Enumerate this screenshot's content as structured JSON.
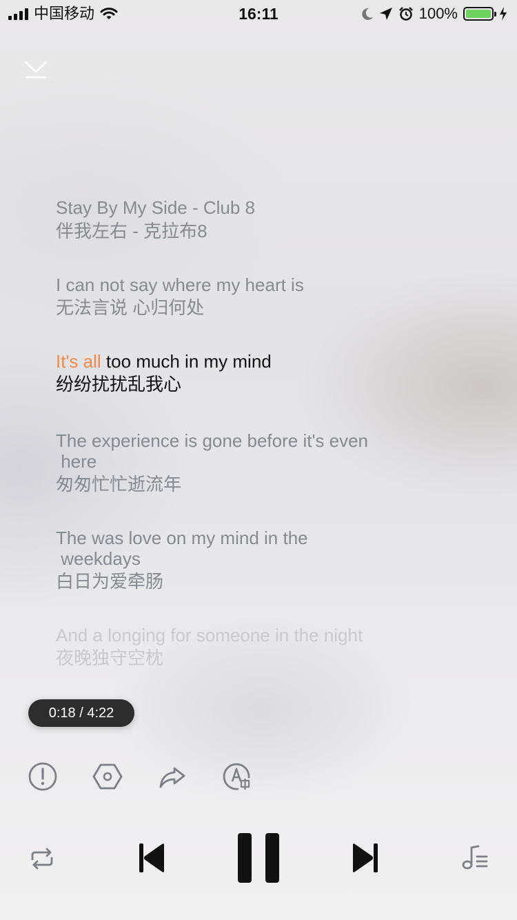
{
  "status_bar": {
    "carrier": "中国移动",
    "time": "16:11",
    "battery": "100%",
    "signal_icon": "signal-bars-icon",
    "wifi_icon": "wifi-icon",
    "icons": [
      "moon-icon",
      "location-arrow-icon",
      "alarm-icon",
      "battery-icon",
      "charging-bolt-icon"
    ]
  },
  "header": {
    "collapse_icon": "chevron-down-collapse-icon"
  },
  "lyrics": {
    "title": {
      "en": "Stay By My Side - Club 8",
      "cn": "伴我左右 - 克拉布8"
    },
    "lines": [
      {
        "en": "I can not say where my heart is",
        "cn": "无法言说 心归何处",
        "state": "past"
      },
      {
        "en_sung": "It's all",
        "en_rest": " too much in my mind",
        "cn": "纷纷扰扰乱我心",
        "state": "current"
      },
      {
        "en1": "The experience is gone before it's even",
        "en2": " here",
        "cn": "匆匆忙忙逝流年",
        "state": "upcoming"
      },
      {
        "en1": "The was love on my mind in the",
        "en2": " weekdays",
        "cn": "白日为爱牵肠",
        "state": "upcoming"
      },
      {
        "en": "And a longing for someone in the night",
        "cn": "夜晚独守空枕",
        "state": "faded"
      }
    ],
    "colors": {
      "highlight": "#f08a4b",
      "current": "#111111",
      "dim": "#878b91",
      "faded": "#c9cacd"
    }
  },
  "playback": {
    "time": "0:18 / 4:22",
    "progress": 0.069
  },
  "actions": {
    "icons": [
      "report-icon",
      "settings-hexagon-icon",
      "share-icon",
      "translate-icon"
    ]
  },
  "controls": {
    "icons": [
      "repeat-icon",
      "previous-icon",
      "pause-icon",
      "next-icon",
      "playlist-icon"
    ]
  }
}
